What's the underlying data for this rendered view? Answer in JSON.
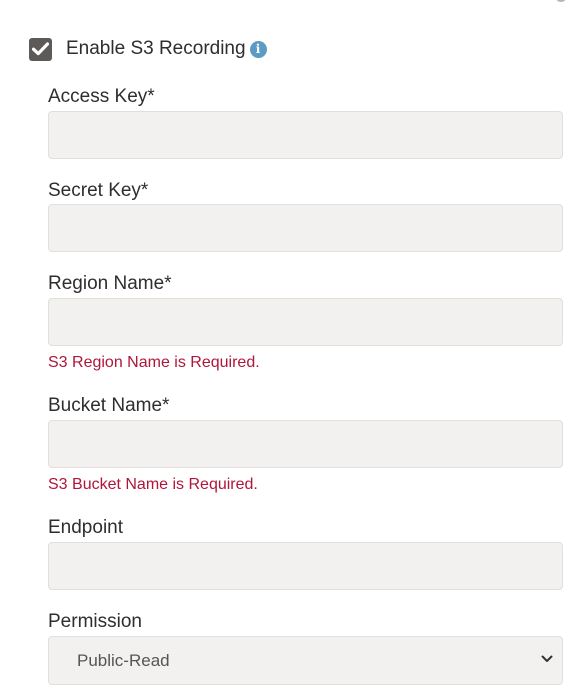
{
  "s3": {
    "enable_label": "Enable S3 Recording",
    "enabled": true,
    "info_icon": "info-icon",
    "fields": {
      "access_key": {
        "label": "Access Key*",
        "value": ""
      },
      "secret_key": {
        "label": "Secret Key*",
        "value": ""
      },
      "region_name": {
        "label": "Region Name*",
        "value": "",
        "error": "S3 Region Name is Required."
      },
      "bucket_name": {
        "label": "Bucket Name*",
        "value": "",
        "error": "S3 Bucket Name is Required."
      },
      "endpoint": {
        "label": "Endpoint",
        "value": ""
      },
      "permission": {
        "label": "Permission",
        "selected": "Public-Read"
      }
    }
  },
  "colors": {
    "checkbox": "#5e5a57",
    "info": "#5b9bc4",
    "error": "#b0153a",
    "input_bg": "#f2f1ef"
  }
}
